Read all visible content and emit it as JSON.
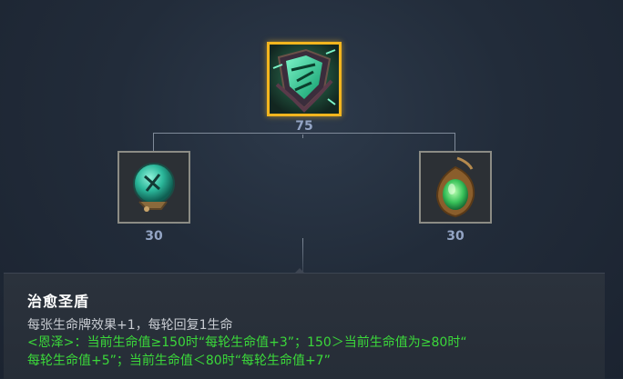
{
  "recipe": {
    "result": {
      "icon": "jade-shield-icon",
      "cost": "75",
      "border_color": "#f3b51e"
    },
    "components": [
      {
        "icon": "jade-orb-icon",
        "cost": "30"
      },
      {
        "icon": "jade-amulet-icon",
        "cost": "30"
      }
    ]
  },
  "tooltip": {
    "title": "治愈圣盾",
    "description": "每张生命牌效果+1，每轮回复1生命",
    "grace_line1": "<恩泽>：当前生命值≥150时“每轮生命值+3”；150＞当前生命值为≥80时“",
    "grace_line2": "每轮生命值+5”；当前生命值＜80时“每轮生命值+7”",
    "grace_color": "#3bd83a"
  }
}
